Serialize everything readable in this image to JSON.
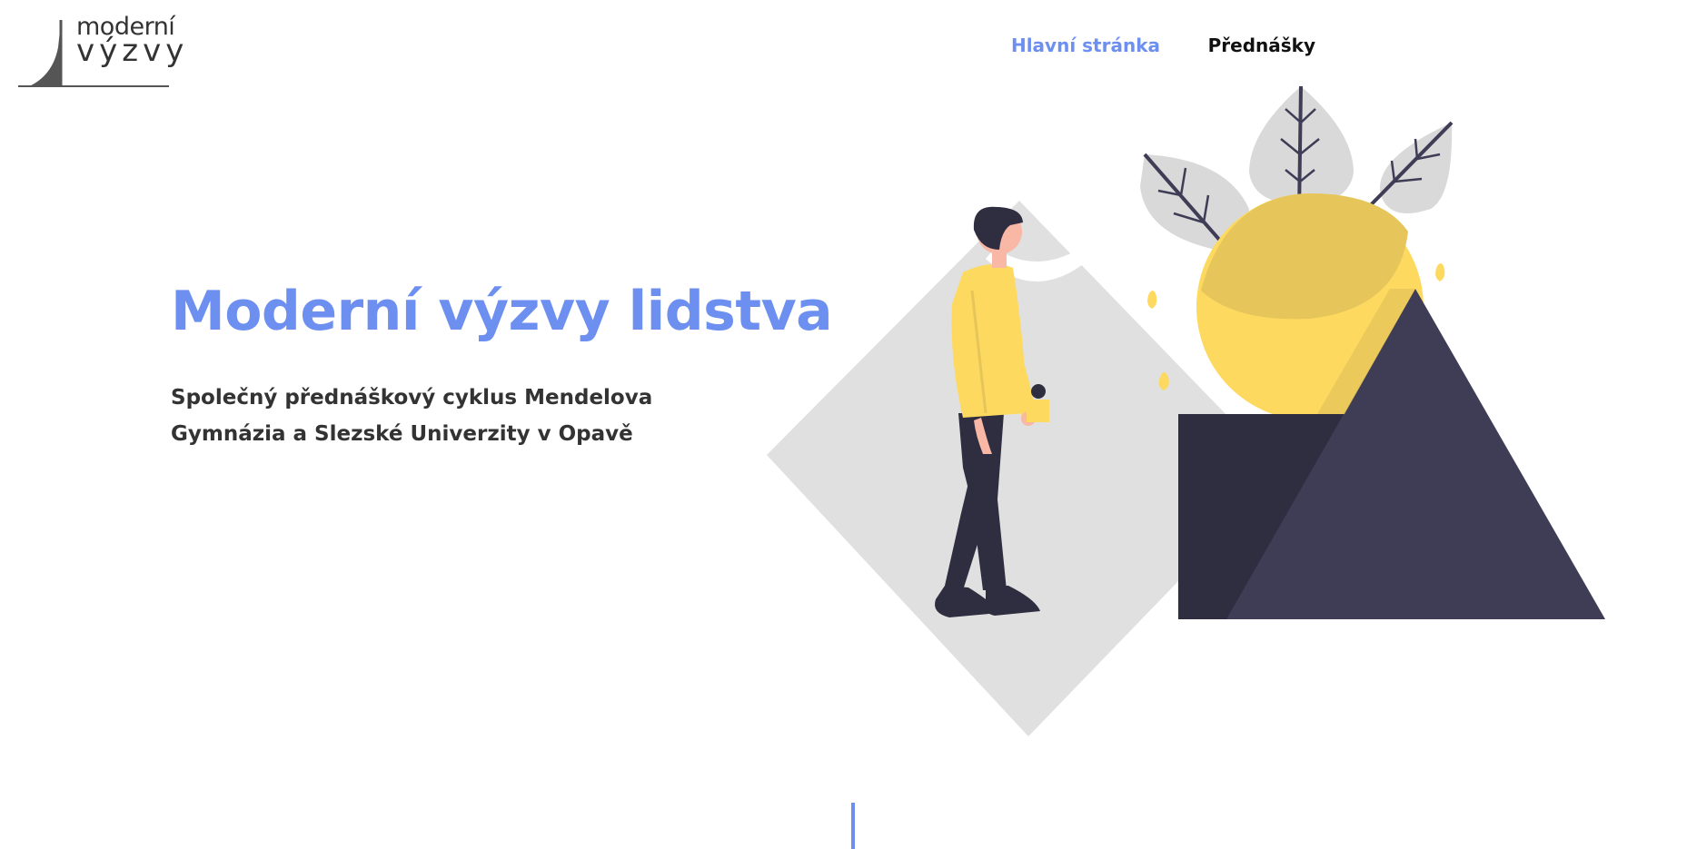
{
  "header": {
    "logo": {
      "line1": "moderní",
      "line2": "výzvy"
    },
    "nav": [
      {
        "label": "Hlavní stránka",
        "active": true
      },
      {
        "label": "Přednášky",
        "active": false
      }
    ]
  },
  "hero": {
    "title": "Moderní výzvy lidstva",
    "subtitle_line1": "Společný přednáškový cyklus Mendelova",
    "subtitle_line2": "Gymnázia a Slezské Univerzity v Opavě"
  },
  "colors": {
    "accent": "#6c8ff0",
    "text": "#333333",
    "yellow": "#fdd95f",
    "dark": "#3f3d56",
    "gray": "#e0e0e0"
  },
  "icons": {
    "logo_mark": "mountain-curve-icon",
    "illustration": "person-with-triangle-and-sun-illustration"
  }
}
